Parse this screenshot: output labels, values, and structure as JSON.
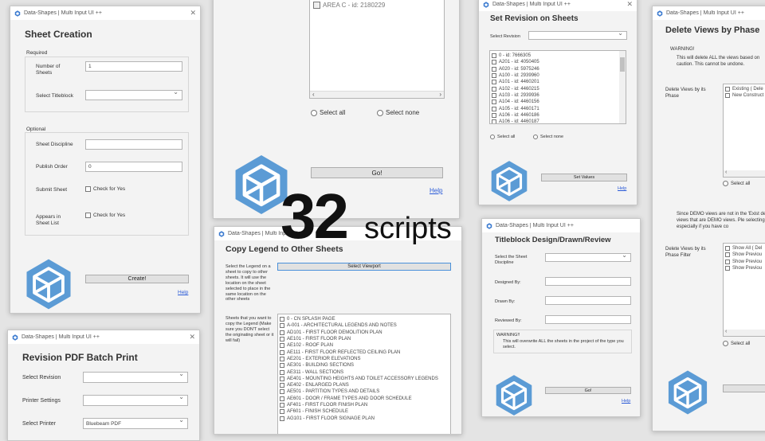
{
  "app_title": "Data-Shapes | Multi Input UI ++",
  "close_glyph": "✕",
  "brand_color": "#5b9bd5",
  "overlay": {
    "number": "32",
    "word": "scripts"
  },
  "w_sheet": {
    "title": "Sheet Creation",
    "required": "Required",
    "num_label": "Number of Sheets",
    "num_value": "1",
    "titleblock_label": "Select Titleblock",
    "optional": "Optional",
    "disc_label": "Sheet Discipline",
    "pub_label": "Publish Order",
    "pub_value": "0",
    "submit_label": "Submit Sheet",
    "check_yes": "Check for Yes",
    "appears_label": "Appears in Sheet List",
    "create": "Create!",
    "help": "Help"
  },
  "w_area": {
    "item": "AREA C - id: 2180229",
    "select_all": "Select all",
    "select_none": "Select none",
    "go": "Go!",
    "help": "Help"
  },
  "w_rev": {
    "title": "Set Revision on Sheets",
    "select_label": "Select Revision",
    "items": [
      "0 - id: 7666305",
      "A201 - id: 4050405",
      "A020 - id: 5975246",
      "A100 - id: 2939960",
      "A101 - id: 4460201",
      "A102 - id: 4460215",
      "A103 - id: 2939936",
      "A104 - id: 4460156",
      "A105 - id: 4460171",
      "A106 - id: 4460186",
      "A106 - id: 4460187"
    ],
    "select_all": "Select all",
    "select_none": "Select none",
    "set": "Set Values",
    "help": "Help"
  },
  "w_del": {
    "title": "Delete Views by Phase",
    "warning": "WARNING!",
    "warn_text": "This will delete ALL the views based on caution. This cannot be undone.",
    "phase_label": "Delete Views by its Phase",
    "phase_items": [
      "Existing ( Dele",
      "New Construct"
    ],
    "select_all": "Select all",
    "note": "Since DEMO views are not in the 'Exist delete views that are DEMO views. Ple selecting this, especially if you have co",
    "filter_label": "Delete Views by its Phase Filter",
    "filter_items": [
      "Show All ( Del",
      "Show Previou",
      "Show Previou",
      "Show Previou"
    ],
    "select_all2": "Select all"
  },
  "w_legend": {
    "title": "Copy Legend to Other Sheets",
    "desc": "Select the Legend on a sheet to copy to other sheets. It will use the location on the sheet selected to place in the same location on the other sheets",
    "viewport_btn": "Select Viewport",
    "sheets_label": "Sheets that you want to copy the Legend (Make sure you DON'T select the originating sheet or it will fail)",
    "items": [
      "0 - CN SPLASH PAGE",
      "A-001 - ARCHITECTURAL LEGENDS AND NOTES",
      "AD101 - FIRST FLOOR DEMOLITION PLAN",
      "AE101 - FIRST FLOOR PLAN",
      "AE102 - ROOF PLAN",
      "AE111 - FIRST FLOOR REFLECTED CEILING PLAN",
      "AE201 - EXTERIOR ELEVATIONS",
      "AE301 - BUILDING SECTIONS",
      "AE311 - WALL SECTIONS",
      "AE401 - MOUNTING HEIGHTS AND TOILET ACCESSORY LEGENDS",
      "AE402 - ENLARGED PLANS",
      "AE501 - PARTITION TYPES AND DETAILS",
      "AE601 - DOOR / FRAME TYPES AND DOOR SCHEDULE",
      "AF401 - FIRST FLOOR FINISH PLAN",
      "AF601 - FINISH SCHEDULE",
      "AG101 - FIRST FLOOR SIGNAGE PLAN"
    ]
  },
  "w_tblock": {
    "title": "Titleblock Design/Drawn/Review",
    "disc_label": "Select the Sheet Discipline",
    "designed": "Designed By:",
    "drawn": "Drawn By:",
    "reviewed": "Reviewed By:",
    "warning": "WARNING!!",
    "warn_text": "This will overwrite ALL the sheets in the project of the type you select.",
    "go": "Go!",
    "help": "Help"
  },
  "w_pdf": {
    "title": "Revision PDF Batch Print",
    "rev_label": "Select Revision",
    "printer_settings": "Printer Settings",
    "printer_label": "Select Printer",
    "printer_value": "Bluebeam PDF"
  }
}
